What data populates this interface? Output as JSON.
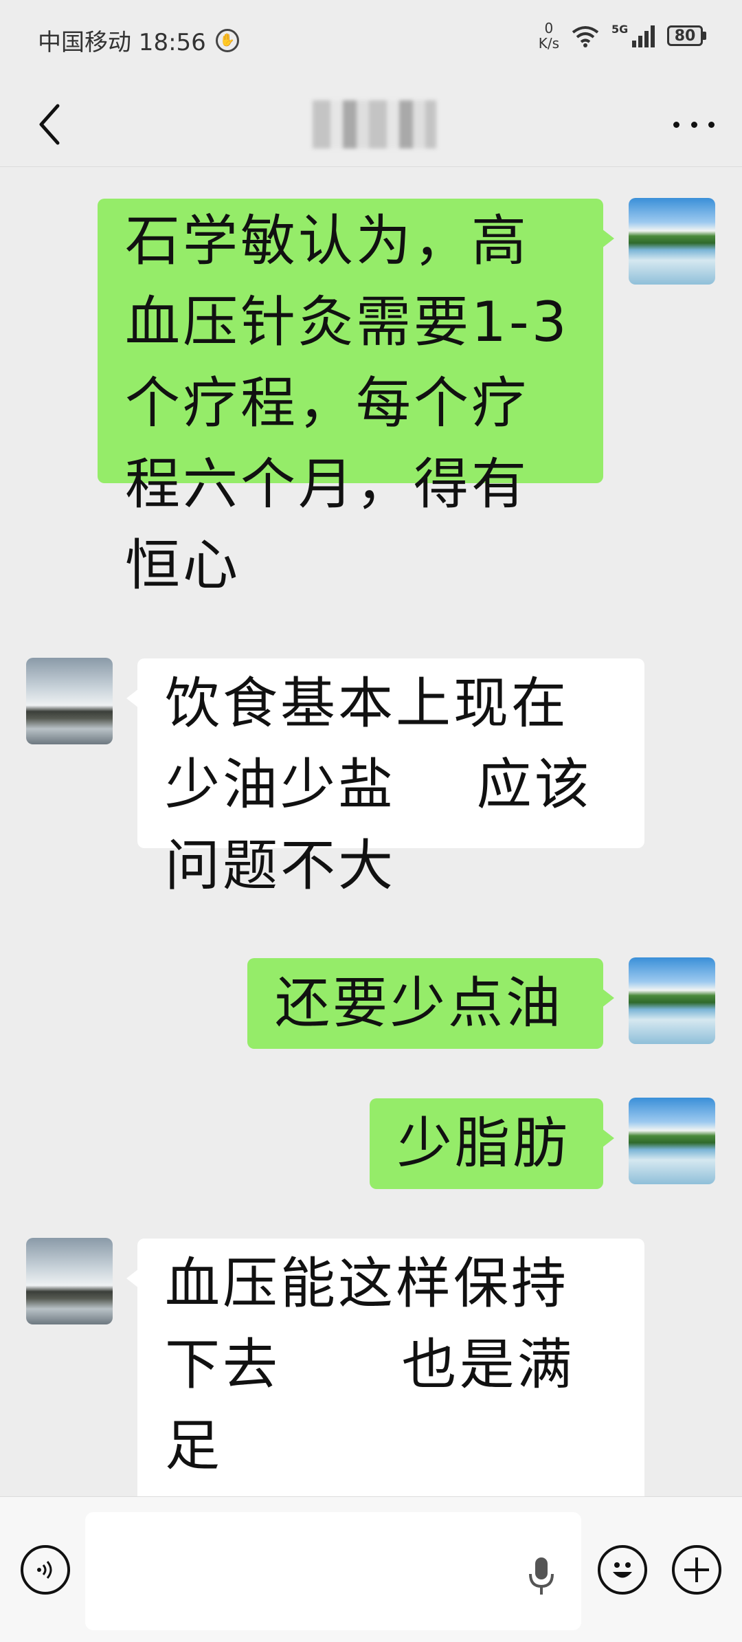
{
  "status_bar": {
    "carrier_time": "中国移动 18:56",
    "net_speed_value": "0",
    "net_speed_unit": "K/s",
    "network_type": "5G",
    "battery_level": "80",
    "icons": [
      "shield-icon",
      "wifi-icon",
      "signal-icon",
      "battery-icon"
    ]
  },
  "nav": {
    "title": "",
    "back_icon": "chevron-left-icon",
    "more_icon": "more-dots-icon"
  },
  "messages": [
    {
      "side": "sent",
      "text": "石学敏认为，高\n血压针灸需要1-3\n个疗程，每个疗\n程六个月，得有\n恒心"
    },
    {
      "side": "received",
      "text": "饮食基本上现在\n少油少盐    应该\n问题不大"
    },
    {
      "side": "sent",
      "text": "还要少点油"
    },
    {
      "side": "sent",
      "text": "少脂肪"
    },
    {
      "side": "received",
      "text": "血压能这样保持\n下去      也是满足\n了"
    }
  ],
  "input_bar": {
    "placeholder": "",
    "icons": [
      "voice-icon",
      "mic-icon",
      "emoji-icon",
      "plus-icon"
    ]
  },
  "colors": {
    "background": "#ededed",
    "sent_bubble": "#95ec69",
    "received_bubble": "#ffffff",
    "input_bar": "#f7f7f7"
  }
}
